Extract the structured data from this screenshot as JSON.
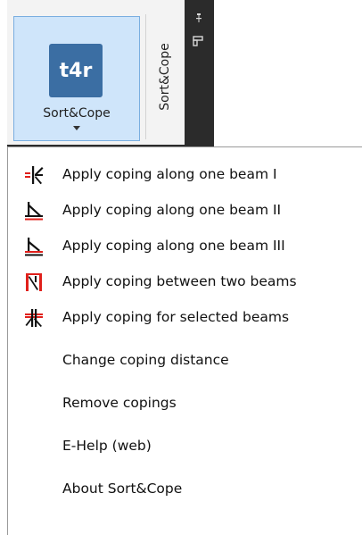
{
  "ribbon": {
    "button_icon_text": "t4r",
    "button_label": "Sort&Cope",
    "panel_title": "Sort&Cope"
  },
  "menu": {
    "items": [
      {
        "label": "Apply coping along one beam I",
        "icon": "cope-beam-1-icon"
      },
      {
        "label": "Apply coping along one beam II",
        "icon": "cope-beam-2-icon"
      },
      {
        "label": "Apply coping along one beam III",
        "icon": "cope-beam-3-icon"
      },
      {
        "label": "Apply coping between two beams",
        "icon": "cope-two-beams-icon"
      },
      {
        "label": "Apply coping for selected beams",
        "icon": "cope-selected-beams-icon"
      },
      {
        "label": "Change coping distance"
      },
      {
        "label": "Remove copings"
      },
      {
        "label": "E-Help (web)"
      },
      {
        "label": "About Sort&Cope"
      }
    ]
  },
  "colors": {
    "accent_red": "#e0201b",
    "button_highlight": "#cfe5fa",
    "icon_blue": "#3b6ea3",
    "dark_strip": "#2b2b2b"
  }
}
